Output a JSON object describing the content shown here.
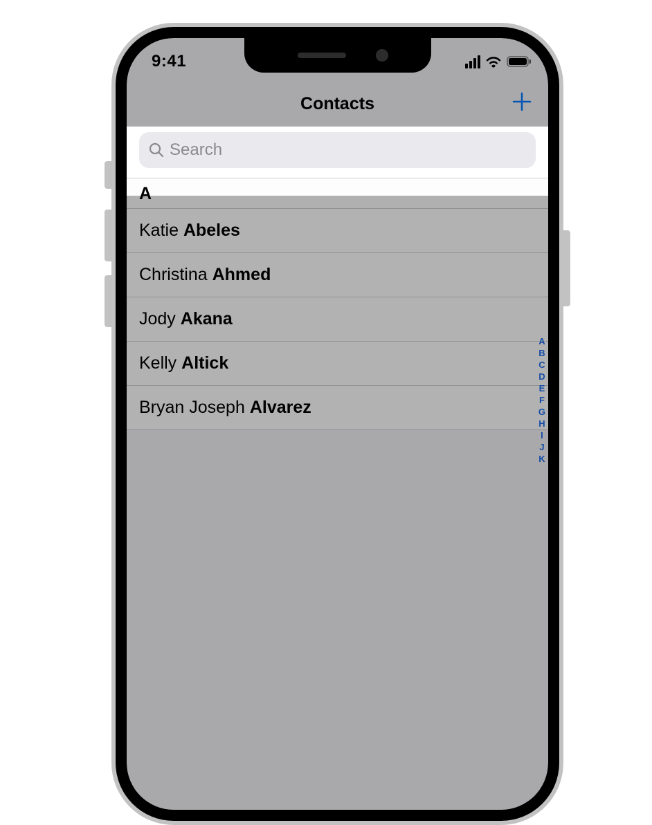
{
  "status": {
    "time": "9:41"
  },
  "nav": {
    "title": "Contacts"
  },
  "search": {
    "placeholder": "Search",
    "value": ""
  },
  "section": {
    "letter": "A"
  },
  "contacts": [
    {
      "first": "Katie",
      "last": "Abeles"
    },
    {
      "first": "Christina",
      "last": "Ahmed"
    },
    {
      "first": "Jody",
      "last": "Akana"
    },
    {
      "first": "Kelly",
      "last": "Altick"
    },
    {
      "first": "Bryan Joseph",
      "last": "Alvarez"
    }
  ],
  "index": [
    "A",
    "B",
    "C",
    "D",
    "E",
    "F",
    "G",
    "H",
    "I",
    "J",
    "K"
  ]
}
